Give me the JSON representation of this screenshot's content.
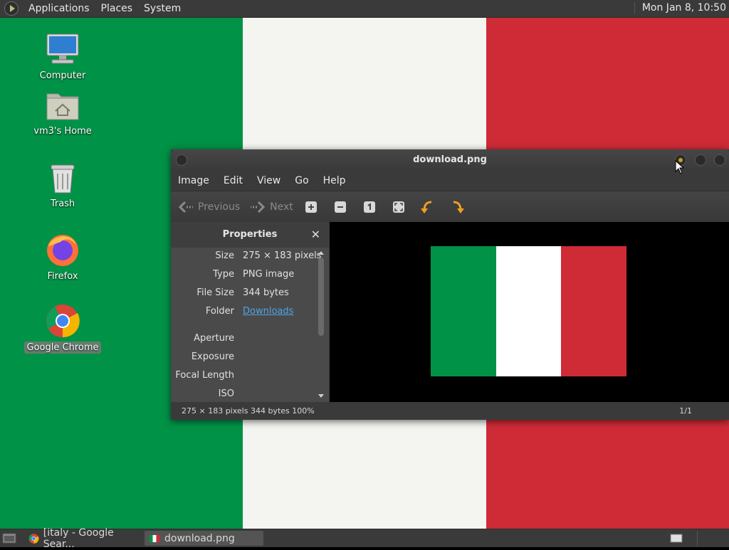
{
  "top_panel": {
    "menus": [
      "Applications",
      "Places",
      "System"
    ],
    "clock": "Mon Jan  8, 10:50"
  },
  "desktop": {
    "icons": [
      {
        "label": "Computer",
        "icon": "computer-icon"
      },
      {
        "label": "vm3's Home",
        "icon": "home-folder-icon"
      },
      {
        "label": "Trash",
        "icon": "trash-icon"
      },
      {
        "label": "Firefox",
        "icon": "firefox-icon"
      },
      {
        "label": "Google Chrome",
        "icon": "chrome-icon",
        "selected": true
      }
    ]
  },
  "viewer": {
    "title": "download.png",
    "menu": [
      "Image",
      "Edit",
      "View",
      "Go",
      "Help"
    ],
    "toolbar": {
      "previous_label": "Previous",
      "next_label": "Next",
      "tools": [
        "zoom-in-icon",
        "zoom-out-icon",
        "normal-size-icon",
        "best-fit-icon",
        "rotate-left-icon",
        "rotate-right-icon"
      ]
    },
    "properties": {
      "title": "Properties",
      "rows": [
        {
          "key": "Size",
          "value": "275 × 183 pixels"
        },
        {
          "key": "Type",
          "value": "PNG image"
        },
        {
          "key": "File Size",
          "value": "344 bytes"
        },
        {
          "key": "Folder",
          "value": "Downloads"
        },
        {
          "key": "Aperture",
          "value": ""
        },
        {
          "key": "Exposure",
          "value": ""
        },
        {
          "key": "Focal Length",
          "value": ""
        },
        {
          "key": "ISO",
          "value": ""
        }
      ]
    },
    "image": {
      "flag_colors": [
        "#009246",
        "#ffffff",
        "#ce2b37"
      ]
    },
    "status": {
      "left": "275 × 183 pixels  344 bytes  100%",
      "right": "1/1"
    }
  },
  "taskbar": {
    "items": [
      {
        "label": "[italy - Google Sear...",
        "icon": "chrome-icon"
      },
      {
        "label": "download.png",
        "icon": "italy-flag-icon",
        "active": true
      }
    ]
  },
  "colors": {
    "panel": "#3a3a3a",
    "accent_link": "#4ea3e8",
    "flag_green": "#009246",
    "flag_white": "#f4f5f0",
    "flag_red": "#ce2b37"
  }
}
